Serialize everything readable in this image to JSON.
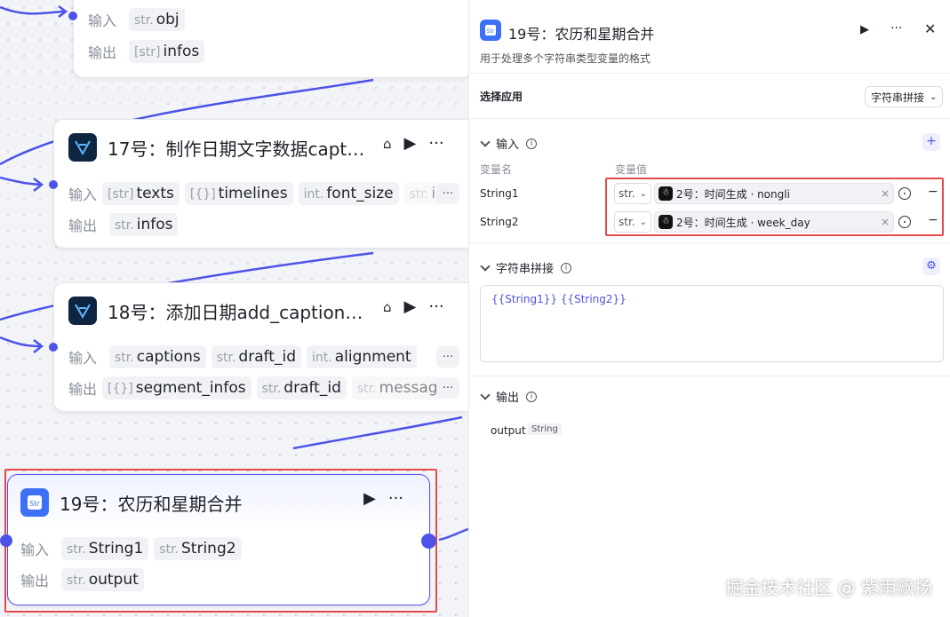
{
  "node_top": {
    "inputs_label": "输入",
    "outputs_label": "输出",
    "input_tag": {
      "type": "str.",
      "name": "obj"
    },
    "output_tag": {
      "type": "[str]",
      "name": "infos"
    }
  },
  "node17": {
    "title": "17号：制作日期文字数据capt…",
    "inputs_label": "输入",
    "outputs_label": "输出",
    "inputs": [
      {
        "type": "[str]",
        "name": "texts"
      },
      {
        "type": "[{}]",
        "name": "timelines"
      },
      {
        "type": "int.",
        "name": "font_size"
      },
      {
        "type": "str.",
        "name": "in"
      }
    ],
    "outputs": [
      {
        "type": "str.",
        "name": "infos"
      }
    ]
  },
  "node18": {
    "title": "18号：添加日期add_caption…",
    "inputs_label": "输入",
    "outputs_label": "输出",
    "inputs": [
      {
        "type": "str.",
        "name": "captions"
      },
      {
        "type": "str.",
        "name": "draft_id"
      },
      {
        "type": "int.",
        "name": "alignment"
      }
    ],
    "outputs": [
      {
        "type": "[{}]",
        "name": "segment_infos"
      },
      {
        "type": "str.",
        "name": "draft_id"
      },
      {
        "type": "str.",
        "name": "messag"
      }
    ]
  },
  "node19": {
    "title": "19号：农历和星期合并",
    "inputs_label": "输入",
    "outputs_label": "输出",
    "inputs": [
      {
        "type": "str.",
        "name": "String1"
      },
      {
        "type": "str.",
        "name": "String2"
      }
    ],
    "outputs": [
      {
        "type": "str.",
        "name": "output"
      }
    ]
  },
  "panel": {
    "title": "19号：农历和星期合并",
    "description": "用于处理多个字符串类型变量的格式",
    "app_select_label": "选择应用",
    "app_select_value": "字符串拼接",
    "input_section": "输入",
    "col_var_name": "变量名",
    "col_var_value": "变量值",
    "vars": [
      {
        "name": "String1",
        "type": "str.",
        "ref": "2号：时间生成 · nongli"
      },
      {
        "name": "String2",
        "type": "str.",
        "ref": "2号：时间生成 · week_day"
      }
    ],
    "concat_section": "字符串拼接",
    "template_text": "{{String1}}  {{String2}}",
    "output_section": "输出",
    "output_name": "output",
    "output_type": "String"
  },
  "watermark": "掘金技术社区 @ 紫雨飘扬",
  "colors": {
    "accent": "#4d53e8",
    "highlight": "#e64a4a",
    "node_icon_blue": "#3c71f7"
  }
}
